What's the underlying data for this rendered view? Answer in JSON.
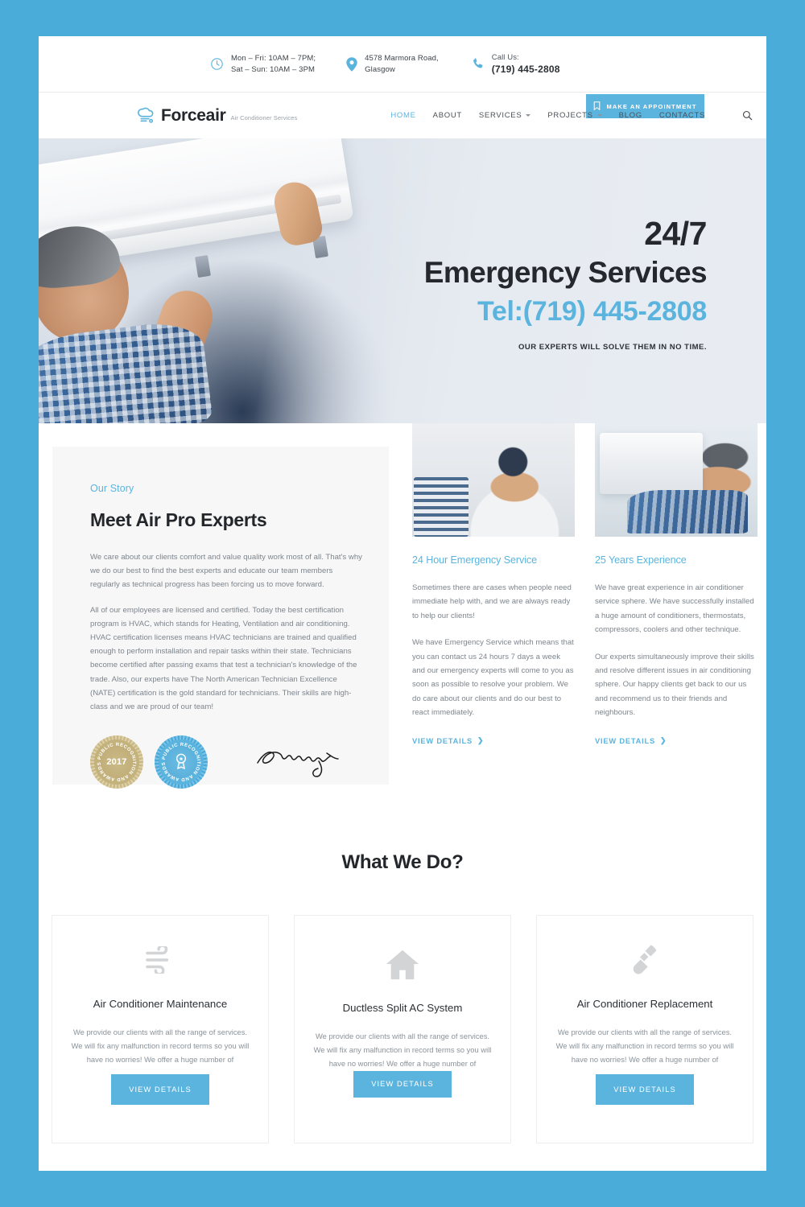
{
  "theme": {
    "accent": "#5bb4de",
    "page_border": "#4aacd8",
    "heading": "#23272b",
    "body_text": "#7d858d",
    "panel_bg": "#f7f7f7"
  },
  "topbar": {
    "hours_line1": "Mon – Fri: 10AM – 7PM;",
    "hours_line2": "Sat – Sun: 10AM – 3PM",
    "address_line1": "4578 Marmora Road,",
    "address_line2": "Glasgow",
    "call_label": "Call Us:",
    "phone": "(719) 445-2808",
    "appointment_button": "MAKE AN APPOINTMENT",
    "icons": {
      "clock": "clock-icon",
      "pin": "map-pin-icon",
      "phone": "phone-icon",
      "appointment": "bookmark-icon"
    }
  },
  "nav": {
    "logo_name": "Forceair",
    "logo_tagline": "Air Conditioner Services",
    "items": [
      {
        "label": "HOME",
        "active": true,
        "has_dropdown": false
      },
      {
        "label": "ABOUT",
        "active": false,
        "has_dropdown": false
      },
      {
        "label": "SERVICES",
        "active": false,
        "has_dropdown": true
      },
      {
        "label": "PROJECTS",
        "active": false,
        "has_dropdown": true
      },
      {
        "label": "BLOG",
        "active": false,
        "has_dropdown": false
      },
      {
        "label": "CONTACTS",
        "active": false,
        "has_dropdown": false
      }
    ],
    "search_icon": "search-icon"
  },
  "hero": {
    "kicker": "24/7",
    "title": "Emergency Services",
    "tel": "Tel:(719) 445-2808",
    "subtitle": "OUR EXPERTS WILL SOLVE THEM IN NO TIME."
  },
  "story": {
    "eyebrow": "Our Story",
    "heading": "Meet Air Pro Experts",
    "paragraph1": "We care about our clients comfort and value quality work most of all. That's why we do our best to find the best experts and educate our team members regularly as technical progress has been forcing us to move forward.",
    "paragraph2": "All of our employees are licensed and certified. Today the best certification program is HVAC, which stands for Heating, Ventilation and air conditioning. HVAC certification licenses means HVAC technicians are trained and qualified enough to perform installation and repair tasks within their state. Technicians become certified after passing exams that test a technician's knowledge of the trade. Also, our experts have The North American Technician Excellence (NATE) certification is the gold standard for technicians. Their skills are high-class and we are proud of our team!",
    "badges": [
      {
        "name": "award-seal-gold",
        "ring_text": "PUBLIC RECOGNITION AND AWARDS",
        "center_text": "2017"
      },
      {
        "name": "award-seal-blue",
        "ring_text": "PUBLIC RECOGNITION AND AWARDS",
        "center_text": ""
      }
    ],
    "signature_alt": "signature"
  },
  "columns": [
    {
      "image": "technician-with-tablet-photo",
      "title": "24 Hour Emergency Service",
      "paragraph1": "Sometimes there are cases when people need immediate help with, and we are always ready to help our clients!",
      "paragraph2": "We have Emergency Service which means that you can contact us 24 hours 7 days a week and our emergency experts will come to you as soon as possible to resolve your problem. We do care about our clients and do our best to react immediately.",
      "link": "VIEW DETAILS"
    },
    {
      "image": "technician-servicing-wall-ac-photo",
      "title": "25 Years Experience",
      "paragraph1": "We have great experience in air conditioner service sphere. We have successfully installed a huge amount of conditioners, thermostats, compressors, coolers and other technique.",
      "paragraph2": "Our experts simultaneously improve their skills and resolve different issues in air conditioning sphere. Our happy clients get back to our us and recommend us to their friends and neighbours.",
      "link": "VIEW DETAILS"
    }
  ],
  "what_we_do": {
    "title": "What We Do?",
    "cards": [
      {
        "icon": "wind-icon",
        "title": "Air Conditioner Maintenance",
        "text": "We provide our clients with all the range of services. We will fix any malfunction in record terms so you will have no worries! We offer a huge number of",
        "button": "VIEW DETAILS"
      },
      {
        "icon": "house-icon",
        "title": "Ductless Split AC System",
        "text": "We provide our clients with all the range of services. We will fix any malfunction in record terms so you will have no worries! We offer a huge number of",
        "button": "VIEW DETAILS"
      },
      {
        "icon": "screwdriver-icon",
        "title": "Air Conditioner Replacement",
        "text": "We provide our clients with all the range of services. We will fix any malfunction in record terms so you will have no worries! We offer a huge number of",
        "button": "VIEW DETAILS"
      }
    ]
  }
}
